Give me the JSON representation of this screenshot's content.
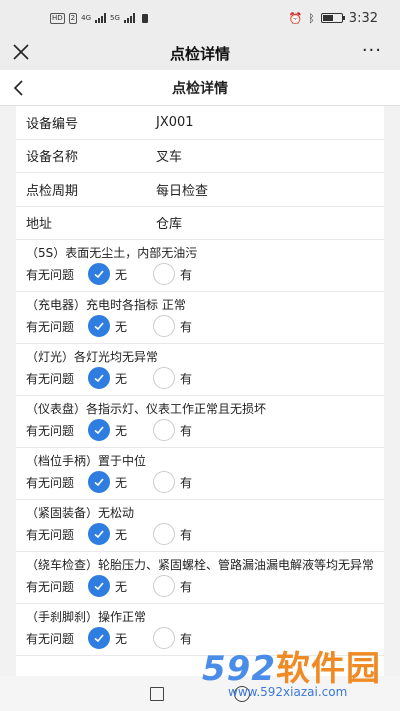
{
  "status": {
    "time": "3:32",
    "hd": "HD",
    "sim": "2",
    "net1": "4G",
    "net2": "5G",
    "battery_level": 0.55
  },
  "wechat": {
    "title": "点检详情",
    "more": "···"
  },
  "nav": {
    "title": "点检详情"
  },
  "info": [
    {
      "label": "设备编号",
      "value": "JX001"
    },
    {
      "label": "设备名称",
      "value": "叉车"
    },
    {
      "label": "点检周期",
      "value": "每日检查"
    },
    {
      "label": "地址",
      "value": "仓库"
    }
  ],
  "question_label": "有无问题",
  "option_no": "无",
  "option_yes": "有",
  "items": [
    {
      "title": "（5S）表面无尘土，内部无油污",
      "answer": "无"
    },
    {
      "title": "（充电器）充电时各指标 正常",
      "answer": "无"
    },
    {
      "title": "（灯光）各灯光均无异常",
      "answer": "无"
    },
    {
      "title": "（仪表盘）各指示灯、仪表工作正常且无损坏",
      "answer": "无"
    },
    {
      "title": "（档位手柄）置于中位",
      "answer": "无"
    },
    {
      "title": "（紧固装备）无松动",
      "answer": "无"
    },
    {
      "title": "（绕车检查）轮胎压力、紧固螺栓、管路漏油漏电解液等均无异常",
      "answer": "无"
    },
    {
      "title": "（手刹脚刹）操作正常",
      "answer": "无"
    }
  ],
  "watermark": {
    "digits": "592",
    "text": "软件园",
    "url": "www.592xiazai.com"
  },
  "colors": {
    "accent": "#2f7de1",
    "watermark_blue": "#4a8de8",
    "watermark_orange": "#f08a24"
  }
}
